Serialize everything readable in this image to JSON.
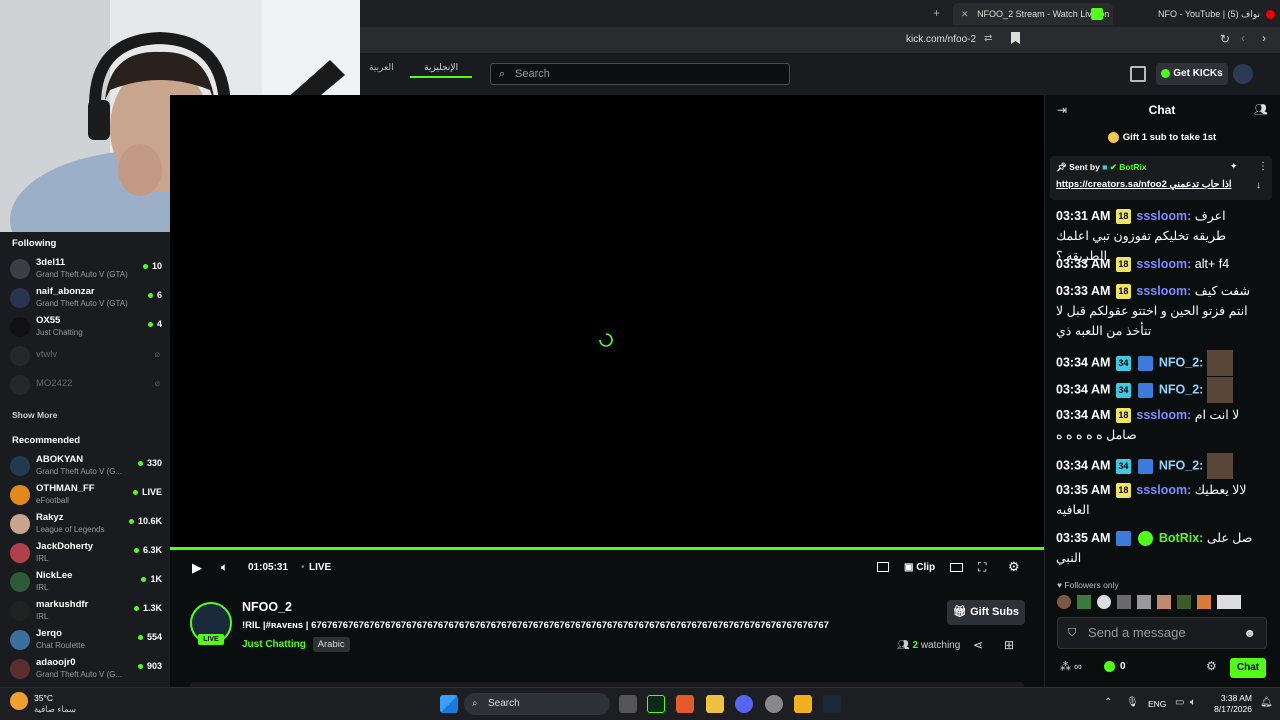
{
  "browser": {
    "tabs": [
      {
        "label": "NFOO_2 Stream - Watch Live on",
        "active": true
      },
      {
        "label": "NFO - YouTube | نواف (5)",
        "active": false
      }
    ],
    "url": "kick.com/nfoo-2"
  },
  "header": {
    "lang_tabs": [
      "العربية",
      "الإنجليزية"
    ],
    "search_placeholder": "Search",
    "get_kicks": "Get KICKs"
  },
  "sidebar": {
    "following_title": "Following",
    "following": [
      {
        "name": "3del11",
        "category": "Grand Theft Auto V (GTA)",
        "viewers": "10",
        "live": true
      },
      {
        "name": "naif_abonzar",
        "category": "Grand Theft Auto V (GTA)",
        "viewers": "6",
        "live": true
      },
      {
        "name": "OX55",
        "category": "Just Chatting",
        "viewers": "4",
        "live": true
      },
      {
        "name": "vtwlv",
        "category": "",
        "viewers": "",
        "live": false
      },
      {
        "name": "MO2422",
        "category": "",
        "viewers": "",
        "live": false
      }
    ],
    "show_more": "Show More",
    "recommended_title": "Recommended",
    "recommended": [
      {
        "name": "ABOKYAN",
        "category": "Grand Theft Auto V (G...",
        "viewers": "330"
      },
      {
        "name": "OTHMAN_FF",
        "category": "eFootball",
        "viewers": "LIVE"
      },
      {
        "name": "Rakyz",
        "category": "League of Legends",
        "viewers": "10.6K"
      },
      {
        "name": "JackDoherty",
        "category": "IRL",
        "viewers": "6.3K"
      },
      {
        "name": "NickLee",
        "category": "IRL",
        "viewers": "1K"
      },
      {
        "name": "markushdfr",
        "category": "IRL",
        "viewers": "1.3K"
      },
      {
        "name": "Jerqo",
        "category": "Chat Roulette",
        "viewers": "554"
      },
      {
        "name": "adaoojr0",
        "category": "Grand Theft Auto V (G...",
        "viewers": "903"
      }
    ]
  },
  "player": {
    "time": "01:05:31",
    "live": "LIVE",
    "clip": "Clip"
  },
  "stream": {
    "name": "NFOO_2",
    "title": "!RIL |#ʀᴀᴠᴇɴs | 67676767676767676767676767676767676767676767676767676767676767676767676767676767676767676767676767",
    "category": "Just Chatting",
    "tag": "Arabic",
    "live_label": "LIVE",
    "gift_subs": "Gift Subs",
    "watching_count": "2",
    "watching_label": "watching"
  },
  "chat": {
    "title": "Chat",
    "gift_banner": "Gift 1 sub to take 1st",
    "pinned_sent_by": "Sent by",
    "pinned_user": "BotRix",
    "pinned_text": "https://creators.sa/nfoo2 اذا حاب تدعمني",
    "messages": [
      {
        "time": "03:31 AM",
        "badge": "18",
        "user": "sssloom",
        "text": "اعرف طريقه تخليكم تفوزون تبي اعلمك الطريقه ؟"
      },
      {
        "time": "03:33 AM",
        "badge": "18",
        "user": "sssloom",
        "text": "alt+ f4"
      },
      {
        "time": "03:33 AM",
        "badge": "18",
        "user": "sssloom",
        "text": "شفت كيف انتم فزتو الحين و اختتو عقولكم قبل لا تتأخذ من اللعبه ذي"
      },
      {
        "time": "03:34 AM",
        "badge": "34",
        "user": "NFO_2",
        "text": ""
      },
      {
        "time": "03:34 AM",
        "badge": "34",
        "user": "NFO_2",
        "text": ""
      },
      {
        "time": "03:34 AM",
        "badge": "18",
        "user": "sssloom",
        "text": "لا انت ام صامل ه ه ه ه ه"
      },
      {
        "time": "03:34 AM",
        "badge": "34",
        "user": "NFO_2",
        "text": ""
      },
      {
        "time": "03:35 AM",
        "badge": "18",
        "user": "sssloom",
        "text": "لالا يعطيك العافيه"
      },
      {
        "time": "03:35 AM",
        "badge": "",
        "user": "BotRix",
        "text": "صل على النبي"
      }
    ],
    "followers_only": "Followers only",
    "placeholder": "Send a message",
    "points": "0",
    "send_label": "Chat"
  },
  "taskbar": {
    "weather_temp": "35°C",
    "weather_desc": "سماء صافية",
    "search": "Search",
    "lang": "ENG",
    "time": "3:38 AM",
    "date": "8/17/2026"
  },
  "colors": {
    "accent": "#53fc18",
    "bg": "#0b0e0f",
    "panel": "#191b1f",
    "badge18": "#f2e661",
    "badge34": "#3ec9e4",
    "user": "#7b8cff"
  }
}
